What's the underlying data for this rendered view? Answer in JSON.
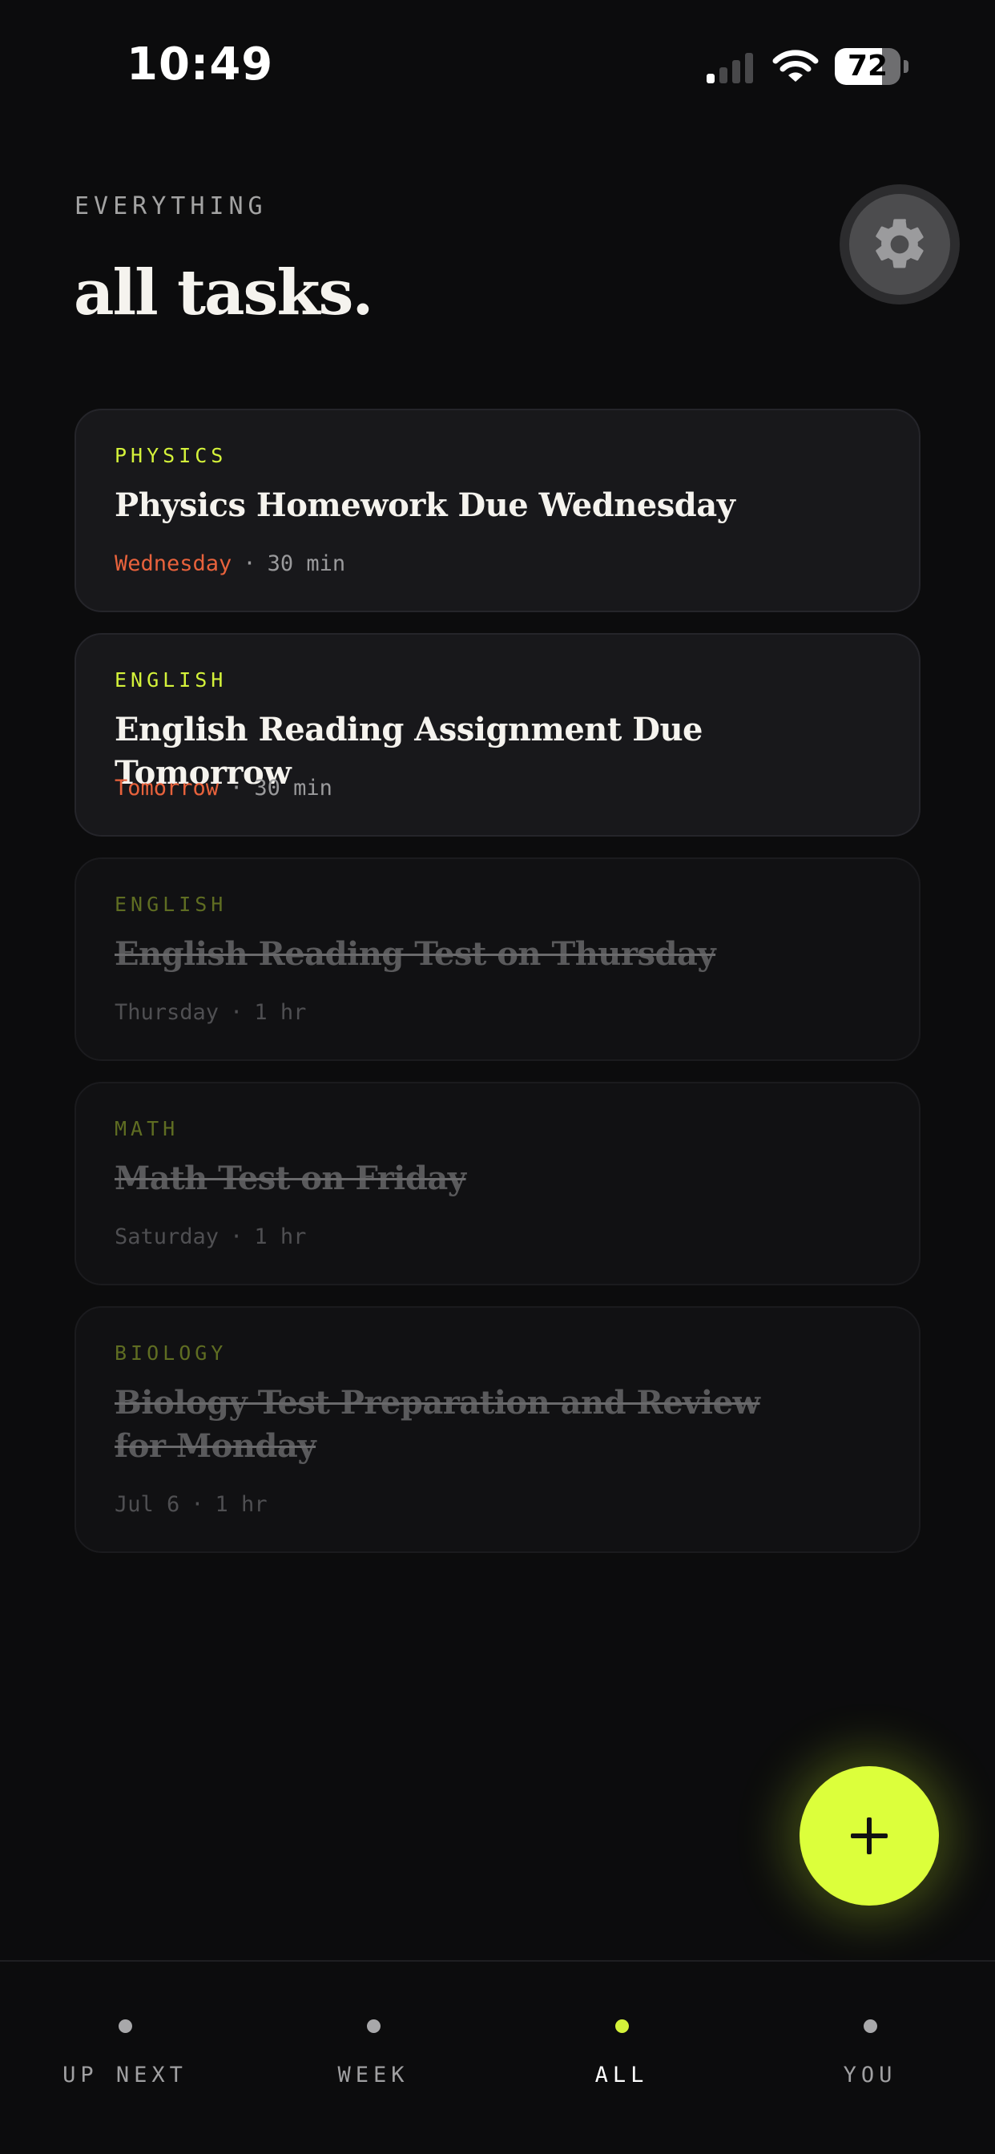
{
  "status_bar": {
    "time": "10:49",
    "battery_percent": "72",
    "battery_level": 0.72,
    "signal_bars_active": 1,
    "signal_bars_total": 4
  },
  "header": {
    "eyebrow": "EVERYTHING",
    "title": "all tasks."
  },
  "settings_button": {
    "icon": "gear-icon"
  },
  "tasks": [
    {
      "subject": "PHYSICS",
      "title": "Physics Homework Due Wednesday",
      "due": "Wednesday",
      "separator": "·",
      "duration": "30 min",
      "completed": false
    },
    {
      "subject": "ENGLISH",
      "title": "English Reading Assignment Due Tomorrow",
      "due": "Tomorrow",
      "separator": "·",
      "duration": "30 min",
      "completed": false
    },
    {
      "subject": "ENGLISH",
      "title": "English Reading Test on Thursday",
      "due": "Thursday",
      "separator": "·",
      "duration": "1 hr",
      "completed": true
    },
    {
      "subject": "MATH",
      "title": "Math Test on Friday",
      "due": "Saturday",
      "separator": "·",
      "duration": "1 hr",
      "completed": true
    },
    {
      "subject": "BIOLOGY",
      "title": "Biology Test Preparation and Review for Monday",
      "due": "Jul 6",
      "separator": "·",
      "duration": "1 hr",
      "completed": true
    }
  ],
  "fab": {
    "icon": "plus-icon"
  },
  "tab_bar": {
    "tabs": [
      {
        "label": "UP NEXT",
        "active": false
      },
      {
        "label": "WEEK",
        "active": false
      },
      {
        "label": "ALL",
        "active": true
      },
      {
        "label": "YOU",
        "active": false
      }
    ]
  },
  "colors": {
    "background": "#0c0c0d",
    "accent": "#d4f23a",
    "fab": "#dcff3b",
    "due_highlight": "#e8623c",
    "card": "#18181b"
  }
}
